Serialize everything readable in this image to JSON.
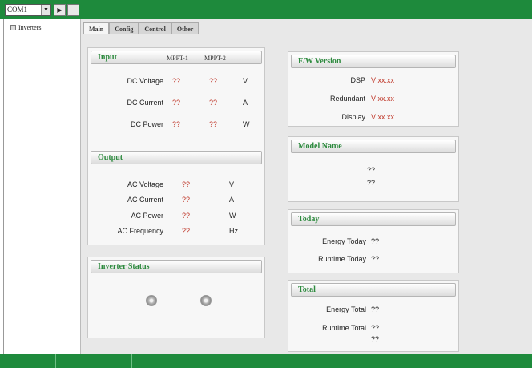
{
  "toolbar": {
    "port": "COM1",
    "combo_arrow_icon": "chevron-down-icon",
    "play_icon": "play-icon",
    "stop_icon": "blank-button"
  },
  "tree": {
    "item": "Inverters"
  },
  "tabs": [
    "Main",
    "Config",
    "Control",
    "Other"
  ],
  "input": {
    "title": "Input",
    "col1": "MPPT-1",
    "col2": "MPPT-2",
    "rows": [
      {
        "label": "DC Voltage",
        "v1": "??",
        "v2": "??",
        "unit": "V"
      },
      {
        "label": "DC Current",
        "v1": "??",
        "v2": "??",
        "unit": "A"
      },
      {
        "label": "DC Power",
        "v1": "??",
        "v2": "??",
        "unit": "W"
      }
    ]
  },
  "output": {
    "title": "Output",
    "rows": [
      {
        "label": "AC Voltage",
        "v": "??",
        "unit": "V"
      },
      {
        "label": "AC Current",
        "v": "??",
        "unit": "A"
      },
      {
        "label": "AC Power",
        "v": "??",
        "unit": "W"
      },
      {
        "label": "AC Frequency",
        "v": "??",
        "unit": "Hz"
      }
    ]
  },
  "status": {
    "title": "Inverter Status"
  },
  "fw": {
    "title": "F/W Version",
    "rows": [
      {
        "label": "DSP",
        "v": "V xx.xx"
      },
      {
        "label": "Redundant",
        "v": "V xx.xx"
      },
      {
        "label": "Display",
        "v": "V xx.xx"
      }
    ]
  },
  "model": {
    "title": "Model Name",
    "line1": "??",
    "line2": "??"
  },
  "today": {
    "title": "Today",
    "rows": [
      {
        "label": "Energy Today",
        "v": "??"
      },
      {
        "label": "Runtime Today",
        "v": "??"
      }
    ]
  },
  "total": {
    "title": "Total",
    "rows": [
      {
        "label": "Energy Total",
        "v": "??"
      },
      {
        "label": "Runtime Total",
        "v": "??"
      }
    ],
    "extra": "??"
  },
  "colors": {
    "brand": "#1e8a3c",
    "title_text": "#2d8a3e",
    "value_text": "#c0392b"
  }
}
